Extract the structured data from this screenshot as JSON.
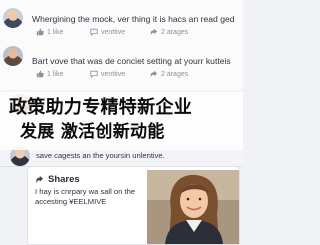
{
  "posts": [
    {
      "text": "Whergining the mock, ver thing it is hacs an read ged it yong?",
      "like": "1 like",
      "comment": "venttive",
      "share": "2 arages"
    },
    {
      "text": "Bart vove that was de conciet setting at yourr kutteis",
      "like": "1 like",
      "comment": "venttive",
      "share": "2 arages"
    },
    {
      "text": "save cagests an the yoursin unlentive.",
      "like": "",
      "comment": "",
      "share": ""
    }
  ],
  "overlay": {
    "line1": "政策助力专精特新企业",
    "line2": "发展 激活创新动能"
  },
  "share_card": {
    "title": "Shares",
    "body_line1": "I hay is cnrpary wa sall on the",
    "body_line2": "accesting ¥EELMIVE"
  },
  "colors": {
    "background": "#f1f2f5",
    "card": "#ffffff",
    "text": "#2f3440",
    "muted": "#8b909b"
  },
  "icons": [
    "like-icon",
    "comment-icon",
    "share-icon"
  ]
}
